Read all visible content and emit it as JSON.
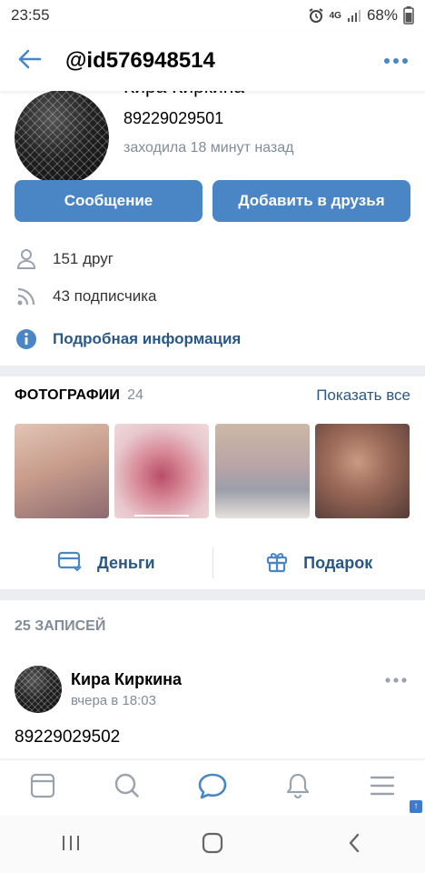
{
  "status_bar": {
    "time": "23:55",
    "network": "4G",
    "battery": "68%"
  },
  "header": {
    "title": "@id576948514",
    "back_icon": "back-arrow-icon",
    "more_icon": "more-icon"
  },
  "profile": {
    "name": "Кира Киркина",
    "phone": "89229029501",
    "last_seen": "заходила 18 минут назад"
  },
  "buttons": {
    "message": "Сообщение",
    "add_friend": "Добавить в друзья"
  },
  "info": {
    "friends": "151 друг",
    "subscribers": "43 подписчика",
    "details": "Подробная информация"
  },
  "photos": {
    "title": "ФОТОГРАФИИ",
    "count": "24",
    "show_all": "Показать все"
  },
  "actions": {
    "money": "Деньги",
    "gift": "Подарок"
  },
  "records": {
    "title": "25 ЗАПИСЕЙ"
  },
  "post": {
    "author": "Кира Киркина",
    "time": "вчера в 18:03",
    "text": "89229029502"
  },
  "colors": {
    "accent": "#4a86c6",
    "link": "#2a5885",
    "secondary_text": "#818c99"
  }
}
